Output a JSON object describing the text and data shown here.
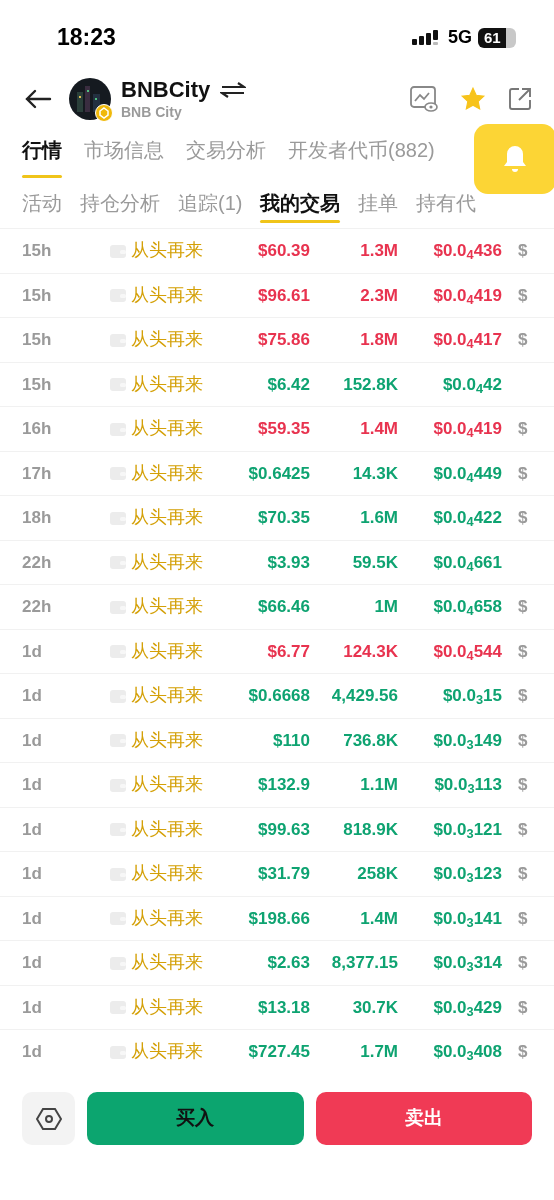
{
  "status_bar": {
    "time": "18:23",
    "network": "5G",
    "battery": "61"
  },
  "header": {
    "title": "BNBCity",
    "subtitle": "BNB City",
    "favorite": true
  },
  "tabs": [
    {
      "label": "行情",
      "selected": true
    },
    {
      "label": "市场信息",
      "selected": false
    },
    {
      "label": "交易分析",
      "selected": false
    },
    {
      "label": "开发者代币(882)",
      "selected": false
    }
  ],
  "subtabs": [
    {
      "label": "活动",
      "selected": false
    },
    {
      "label": "持仓分析",
      "selected": false
    },
    {
      "label": "追踪(1)",
      "selected": false
    },
    {
      "label": "我的交易",
      "selected": true
    },
    {
      "label": "挂单",
      "selected": false
    },
    {
      "label": "持有代",
      "selected": false
    }
  ],
  "rows": [
    {
      "time": "15h",
      "trader": "从头再来",
      "color": "#e8334f",
      "value": "$60.39",
      "amount": "1.3M",
      "price": "$0.0$_{4}$436",
      "column_7": "$"
    },
    {
      "time": "15h",
      "trader": "从头再来",
      "color": "#e8334f",
      "value": "$96.61",
      "amount": "2.3M",
      "price": "$0.0$_{4}$419",
      "column_7": "$"
    },
    {
      "time": "15h",
      "trader": "从头再来",
      "color": "#e8334f",
      "value": "$75.86",
      "amount": "1.8M",
      "price": "$0.0$_{4}$417",
      "column_7": "$"
    },
    {
      "time": "15h",
      "trader": "从头再来",
      "color": "#0ea371",
      "value": "$6.42",
      "amount": "152.8K",
      "price": "$0.0$_{4}$42"
    },
    {
      "time": "16h",
      "trader": "从头再来",
      "color": "#e8334f",
      "value": "$59.35",
      "amount": "1.4M",
      "price": "$0.0$_{4}$419",
      "column_7": "$"
    },
    {
      "time": "17h",
      "trader": "从头再来",
      "color": "#0ea371",
      "value": "$0.6425",
      "amount": "14.3K",
      "price": "$0.0$_{4}$449",
      "column_7": "$"
    },
    {
      "time": "18h",
      "trader": "从头再来",
      "color": "#0ea371",
      "value": "$70.35",
      "amount": "1.6M",
      "price": "$0.0$_{4}$422",
      "column_7": "$"
    },
    {
      "time": "22h",
      "trader": "从头再来",
      "color": "#0ea371",
      "value": "$3.93",
      "amount": "59.5K",
      "price": "$0.0$_{4}$661"
    },
    {
      "time": "22h",
      "trader": "从头再来",
      "color": "#0ea371",
      "value": "$66.46",
      "amount": "1M",
      "price": "$0.0$_{4}$658",
      "column_7": "$"
    },
    {
      "time": "1d",
      "trader": "从头再来",
      "color": "#e8334f",
      "value": "$6.77",
      "amount": "124.3K",
      "price": "$0.0$_{4}$544",
      "column_7": "$"
    },
    {
      "time": "1d",
      "trader": "从头再来",
      "color": "#0ea371",
      "value": "$0.6668",
      "amount": "4,429.56",
      "price": "$0.0$_{3}$15",
      "column_7": "$"
    },
    {
      "time": "1d",
      "trader": "从头再来",
      "color": "#0ea371",
      "value": "$110",
      "amount": "736.8K",
      "price": "$0.0$_{3}$149",
      "column_7": "$"
    },
    {
      "time": "1d",
      "trader": "从头再来",
      "color": "#0ea371",
      "value": "$132.9",
      "amount": "1.1M",
      "price": "$0.0$_{3}$113",
      "column_7": "$"
    },
    {
      "time": "1d",
      "trader": "从头再来",
      "color": "#0ea371",
      "value": "$99.63",
      "amount": "818.9K",
      "price": "$0.0$_{3}$121",
      "column_7": "$"
    },
    {
      "time": "1d",
      "trader": "从头再来",
      "color": "#0ea371",
      "value": "$31.79",
      "amount": "258K",
      "price": "$0.0$_{3}$123",
      "column_7": "$"
    },
    {
      "time": "1d",
      "trader": "从头再来",
      "color": "#0ea371",
      "value": "$198.66",
      "amount": "1.4M",
      "price": "$0.0$_{3}$141",
      "column_7": "$"
    },
    {
      "time": "1d",
      "trader": "从头再来",
      "color": "#0ea371",
      "value": "$2.63",
      "amount": "8,377.15",
      "price": "$0.0$_{3}$314",
      "column_7": "$"
    },
    {
      "time": "1d",
      "trader": "从头再来",
      "color": "#0ea371",
      "value": "$13.18",
      "amount": "30.7K",
      "price": "$0.0$_{3}$429",
      "column_7": "$"
    },
    {
      "time": "1d",
      "trader": "从头再来",
      "color": "#0ea371",
      "value": "$727.45",
      "amount": "1.7M",
      "price": "$0.0$_{3}$408",
      "column_7": "$"
    }
  ],
  "actions": {
    "buy": "买入",
    "sell": "卖出"
  }
}
